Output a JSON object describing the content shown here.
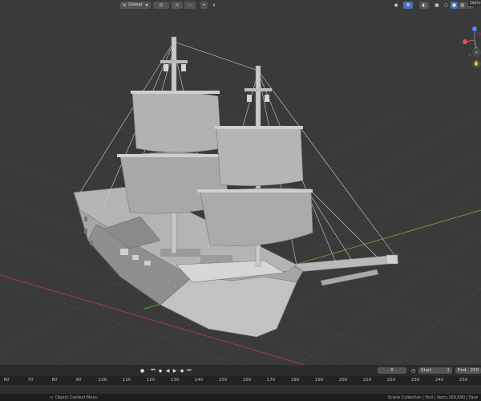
{
  "header": {
    "orientation_label": "Global",
    "options_label": "Optio"
  },
  "timeline": {
    "current_frame": "0",
    "start_label": "Start",
    "start_value": "1",
    "end_label": "End",
    "end_value": "250"
  },
  "ruler": {
    "ticks": [
      "60",
      "70",
      "80",
      "90",
      "100",
      "110",
      "120",
      "130",
      "140",
      "150",
      "160",
      "170",
      "180",
      "190",
      "200",
      "210",
      "220",
      "230",
      "240",
      "250"
    ]
  },
  "status_bar": {
    "left_text": "Object Context Menu",
    "right_text": "Scene Collection | Hull | Verts:169,690 | Face"
  },
  "gizmo": {
    "x_color": "#e84a5f",
    "y_color": "#6bbf3a",
    "z_color": "#4a8ae8"
  }
}
